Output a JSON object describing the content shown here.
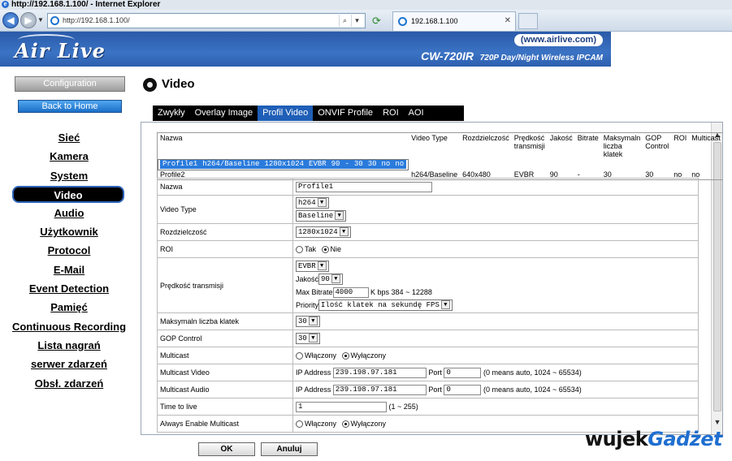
{
  "browser": {
    "window_title": "http://192.168.1.100/ - Internet Explorer",
    "address": "http://192.168.1.100/",
    "tab_title": "192.168.1.100",
    "addr_search_glyph": "⌕",
    "addr_dropdown_glyph": "▾",
    "tab_close_glyph": "✕"
  },
  "banner": {
    "logo": "Air Live",
    "url": "(www.airlive.com)",
    "model": "CW-720IR",
    "tagline": "720P Day/Night Wireless IPCAM"
  },
  "sidebar": {
    "config_label": "Configuration",
    "home_label": "Back to Home",
    "items": [
      {
        "label": "Sieć"
      },
      {
        "label": "Kamera"
      },
      {
        "label": "System"
      },
      {
        "label": "Video"
      },
      {
        "label": "Audio"
      },
      {
        "label": "Użytkownik"
      },
      {
        "label": "Protocol"
      },
      {
        "label": "E-Mail"
      },
      {
        "label": "Event Detection"
      },
      {
        "label": "Pamięć"
      },
      {
        "label": "Continuous Recording"
      },
      {
        "label": "Lista nagrań"
      },
      {
        "label": "serwer zdarzeń"
      },
      {
        "label": "Obsł. zdarzeń"
      }
    ]
  },
  "page": {
    "title": "Video",
    "tabs": [
      "Zwykły",
      "Overlay Image",
      "Profil Video",
      "ONVIF Profile",
      "ROI",
      "AOI"
    ]
  },
  "profiles": {
    "headers": [
      "Nazwa",
      "Video Type",
      "Rozdzielczość",
      "Prędkość transmisji",
      "Jakość",
      "Bitrate",
      "Maksymaln liczba klatek",
      "GOP Control",
      "ROI",
      "Multicast"
    ],
    "rows": [
      [
        "Profile1",
        "h264/Baseline",
        "1280x1024",
        "EVBR",
        "90",
        "-",
        "30",
        "30",
        "no",
        "no"
      ],
      [
        "Profile2",
        "h264/Baseline",
        "640x480",
        "EVBR",
        "90",
        "-",
        "30",
        "30",
        "no",
        "no"
      ]
    ]
  },
  "form": {
    "name_label": "Nazwa",
    "name_value": "Profile1",
    "video_type_label": "Video Type",
    "codec": "h264",
    "profile": "Baseline",
    "resolution_label": "Rozdzielczość",
    "resolution": "1280x1024",
    "roi_label": "ROI",
    "roi_yes": "Tak",
    "roi_no": "Nie",
    "rate_label": "Prędkość transmisji",
    "rate_mode": "EVBR",
    "quality_label": "Jakość",
    "quality": "90",
    "maxbitrate_label": "Max Bitrate",
    "maxbitrate": "4000",
    "maxbitrate_hint": "K bps 384 ~ 12288",
    "priority_label": "Priority",
    "priority": "Ilość klatek na sekundę FPS",
    "fps_label": "Maksymaln liczba klatek",
    "fps": "30",
    "gop_label": "GOP Control",
    "gop": "30",
    "multicast_label": "Multicast",
    "on_label": "Włączony",
    "off_label": "Wyłączony",
    "mvideo_label": "Multicast Video",
    "mvideo_ip_label": "IP Address",
    "mvideo_ip": "239.198.97.181",
    "port_label": "Port",
    "mvideo_port": "0",
    "port_hint": "(0 means auto, 1024 ~ 65534)",
    "maudio_label": "Multicast Audio",
    "maudio_ip": "239.198.97.181",
    "maudio_port": "0",
    "ttl_label": "Time to live",
    "ttl": "1",
    "ttl_hint": "(1 ~ 255)",
    "always_label": "Always Enable Multicast"
  },
  "buttons": {
    "ok": "OK",
    "cancel": "Anuluj"
  },
  "watermark": {
    "a": "wujek",
    "b": "Gadżet"
  }
}
